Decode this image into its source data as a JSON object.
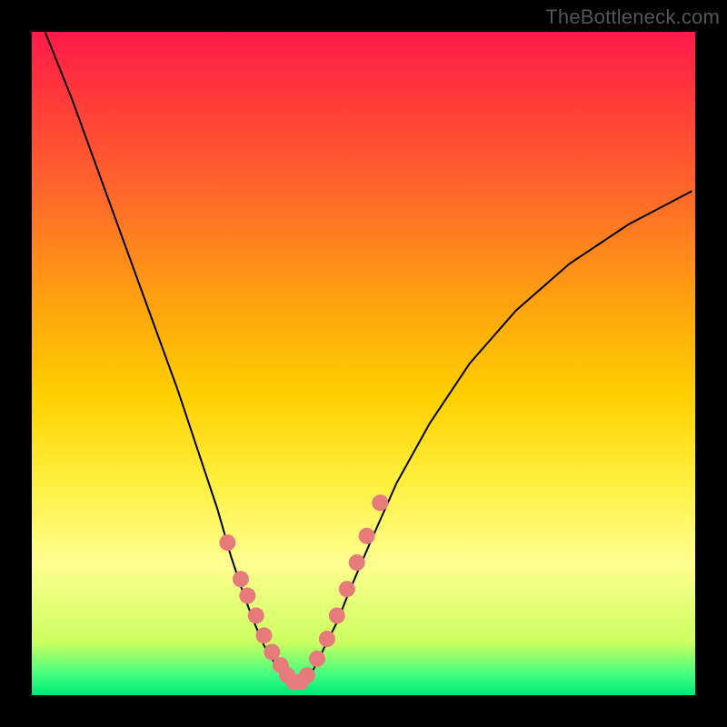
{
  "watermark": "TheBottleneck.com",
  "chart_data": {
    "type": "line",
    "title": "",
    "xlabel": "",
    "ylabel": "",
    "xlim": [
      0,
      100
    ],
    "ylim": [
      0,
      100
    ],
    "series": [
      {
        "name": "left-curve",
        "x": [
          2,
          6,
          10,
          14,
          18,
          22,
          25,
          28,
          30,
          32,
          33.5,
          35,
          36.5,
          38,
          39,
          40
        ],
        "values": [
          100,
          90,
          79,
          68,
          57,
          46,
          37,
          28,
          21,
          15,
          11,
          7.5,
          5,
          3,
          2,
          1.5
        ]
      },
      {
        "name": "right-curve",
        "x": [
          40,
          41,
          42.5,
          44,
          46,
          48,
          51,
          55,
          60,
          66,
          73,
          81,
          90,
          99.5
        ],
        "values": [
          1.5,
          2,
          4,
          7,
          11,
          16,
          23,
          32,
          41,
          50,
          58,
          65,
          71,
          76
        ]
      }
    ],
    "markers": {
      "name": "data-points",
      "x": [
        29.5,
        31.5,
        32.5,
        33.8,
        35,
        36.2,
        37.5,
        38.5,
        39.5,
        40.5,
        41.5,
        43,
        44.5,
        46,
        47.5,
        49,
        50.5,
        52.5
      ],
      "values": [
        23,
        17.5,
        15,
        12,
        9,
        6.5,
        4.5,
        3,
        2,
        2,
        3,
        5.5,
        8.5,
        12,
        16,
        20,
        24,
        29
      ]
    },
    "gradient_stops": [
      {
        "pos": 0,
        "color": "#ff1a4a"
      },
      {
        "pos": 10,
        "color": "#ff3a3a"
      },
      {
        "pos": 25,
        "color": "#ff6a2a"
      },
      {
        "pos": 40,
        "color": "#ffa010"
      },
      {
        "pos": 55,
        "color": "#ffd000"
      },
      {
        "pos": 68,
        "color": "#fff040"
      },
      {
        "pos": 80,
        "color": "#ffff90"
      },
      {
        "pos": 92,
        "color": "#ccff60"
      },
      {
        "pos": 97,
        "color": "#40ff80"
      },
      {
        "pos": 100,
        "color": "#00e676"
      }
    ]
  }
}
